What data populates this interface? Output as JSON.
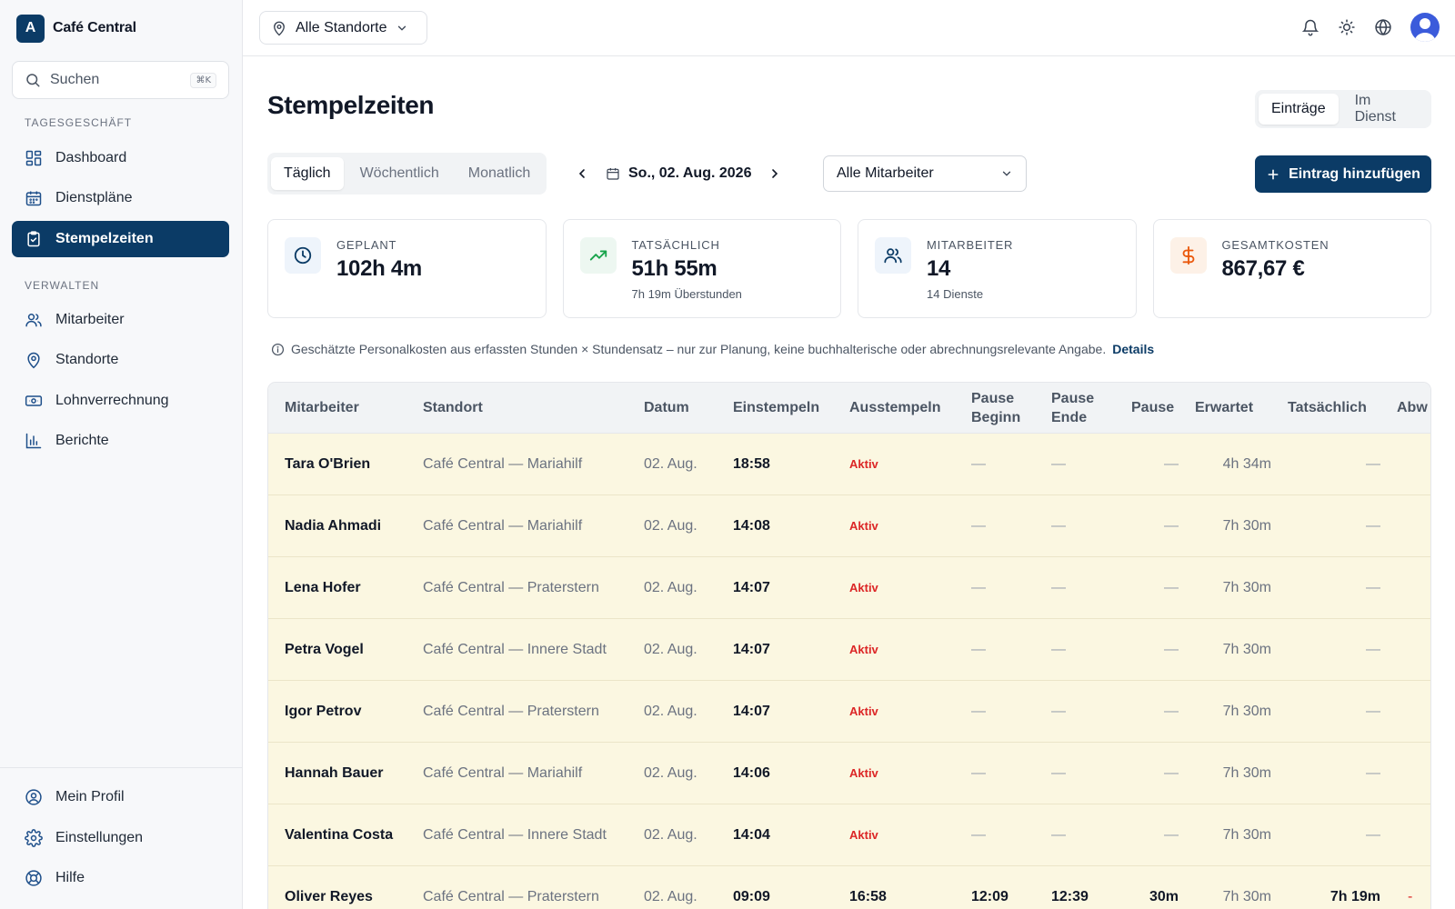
{
  "app": {
    "logo_letter": "A",
    "name": "Café Central"
  },
  "search": {
    "placeholder": "Suchen",
    "shortcut": "⌘K"
  },
  "sidebar": {
    "section_1": "TAGESGESCHÄFT",
    "section_2": "VERWALTEN",
    "items": [
      {
        "label": "Dashboard",
        "icon": "dashboard-icon"
      },
      {
        "label": "Dienstpläne",
        "icon": "calendar-icon"
      },
      {
        "label": "Stempelzeiten",
        "icon": "clipboard-check-icon",
        "active": true
      },
      {
        "label": "Mitarbeiter",
        "icon": "users-icon"
      },
      {
        "label": "Standorte",
        "icon": "map-pin-icon"
      },
      {
        "label": "Lohnverrechnung",
        "icon": "banknote-icon"
      },
      {
        "label": "Berichte",
        "icon": "bar-chart-icon"
      }
    ],
    "bottom_items": [
      {
        "label": "Mein Profil",
        "icon": "user-circle-icon"
      },
      {
        "label": "Einstellungen",
        "icon": "gear-icon"
      },
      {
        "label": "Hilfe",
        "icon": "lifebuoy-icon"
      }
    ]
  },
  "topbar": {
    "location_select": "Alle Standorte"
  },
  "page": {
    "title": "Stempelzeiten",
    "view_toggle": [
      "Einträge",
      "Im Dienst"
    ],
    "period_tabs": [
      "Täglich",
      "Wöchentlich",
      "Monatlich"
    ],
    "date": "So., 02. Aug. 2026",
    "employee_filter": "Alle Mitarbeiter",
    "add_button": "Eintrag hinzufügen"
  },
  "stats": [
    {
      "label": "GEPLANT",
      "value": "102h 4m",
      "sub": ""
    },
    {
      "label": "TATSÄCHLICH",
      "value": "51h 55m",
      "sub": "7h 19m Überstunden"
    },
    {
      "label": "MITARBEITER",
      "value": "14",
      "sub": "14 Dienste"
    },
    {
      "label": "GESAMTKOSTEN",
      "value": "867,67 €",
      "sub": ""
    }
  ],
  "notice": {
    "text": "Geschätzte Personalkosten aus erfassten Stunden × Stundensatz – nur zur Planung, keine buchhalterische oder abrechnungsrelevante Angabe.",
    "link": "Details"
  },
  "colors": {
    "primary": "#0b3b66",
    "active_status": "#dc2626",
    "row_highlight": "#fbf7e1"
  },
  "table": {
    "headers": {
      "name": "Mitarbeiter",
      "location": "Standort",
      "date": "Datum",
      "clock_in": "Einstempeln",
      "clock_out": "Ausstempeln",
      "break_start": "Pause Beginn",
      "break_end": "Pause Ende",
      "break": "Pause",
      "expected": "Erwartet",
      "actual": "Tatsächlich",
      "deviation": "Abw"
    },
    "rows": [
      {
        "name": "Tara O'Brien",
        "location": "Café Central — Mariahilf",
        "date": "02. Aug.",
        "in": "18:58",
        "out": "Aktiv",
        "pb": "—",
        "pe": "—",
        "p": "—",
        "exp": "4h 34m",
        "act": "—",
        "dev": ""
      },
      {
        "name": "Nadia Ahmadi",
        "location": "Café Central — Mariahilf",
        "date": "02. Aug.",
        "in": "14:08",
        "out": "Aktiv",
        "pb": "—",
        "pe": "—",
        "p": "—",
        "exp": "7h 30m",
        "act": "—",
        "dev": ""
      },
      {
        "name": "Lena Hofer",
        "location": "Café Central — Praterstern",
        "date": "02. Aug.",
        "in": "14:07",
        "out": "Aktiv",
        "pb": "—",
        "pe": "—",
        "p": "—",
        "exp": "7h 30m",
        "act": "—",
        "dev": ""
      },
      {
        "name": "Petra Vogel",
        "location": "Café Central — Innere Stadt",
        "date": "02. Aug.",
        "in": "14:07",
        "out": "Aktiv",
        "pb": "—",
        "pe": "—",
        "p": "—",
        "exp": "7h 30m",
        "act": "—",
        "dev": ""
      },
      {
        "name": "Igor Petrov",
        "location": "Café Central — Praterstern",
        "date": "02. Aug.",
        "in": "14:07",
        "out": "Aktiv",
        "pb": "—",
        "pe": "—",
        "p": "—",
        "exp": "7h 30m",
        "act": "—",
        "dev": ""
      },
      {
        "name": "Hannah Bauer",
        "location": "Café Central — Mariahilf",
        "date": "02. Aug.",
        "in": "14:06",
        "out": "Aktiv",
        "pb": "—",
        "pe": "—",
        "p": "—",
        "exp": "7h 30m",
        "act": "—",
        "dev": ""
      },
      {
        "name": "Valentina Costa",
        "location": "Café Central — Innere Stadt",
        "date": "02. Aug.",
        "in": "14:04",
        "out": "Aktiv",
        "pb": "—",
        "pe": "—",
        "p": "—",
        "exp": "7h 30m",
        "act": "—",
        "dev": ""
      },
      {
        "name": "Oliver Reyes",
        "location": "Café Central — Praterstern",
        "date": "02. Aug.",
        "in": "09:09",
        "out": "16:58",
        "pb": "12:09",
        "pe": "12:39",
        "p": "30m",
        "exp": "7h 30m",
        "act": "7h 19m",
        "dev": "-"
      }
    ]
  }
}
